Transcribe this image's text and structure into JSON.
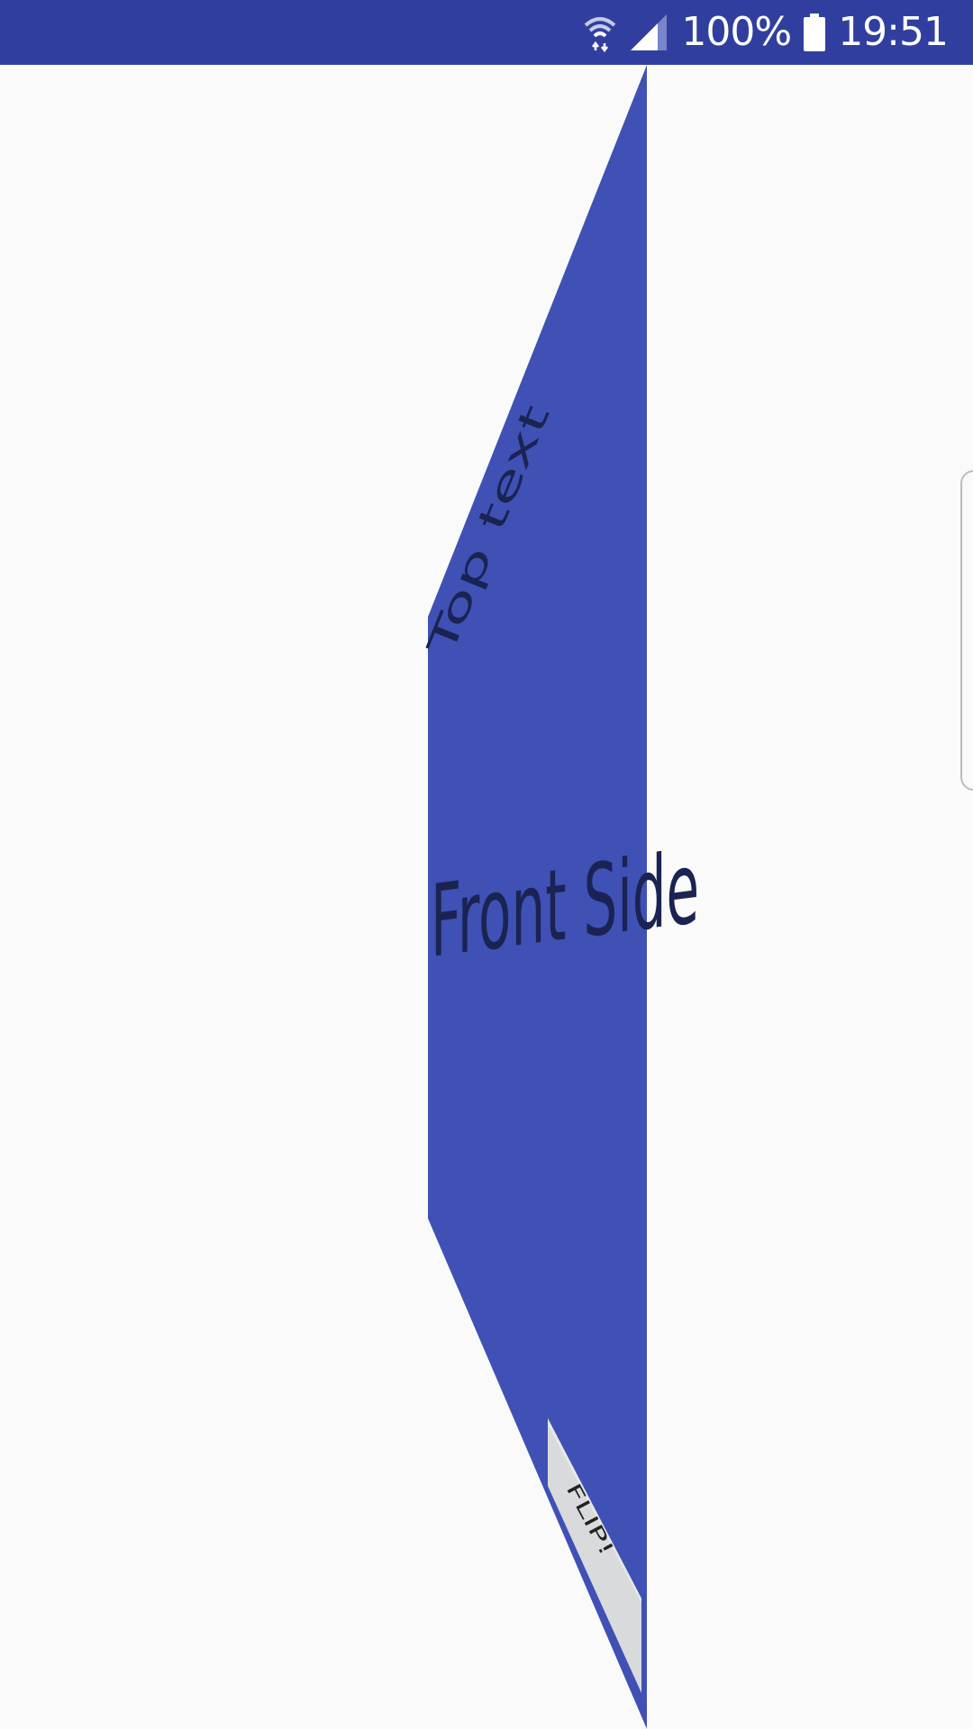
{
  "status_bar": {
    "battery_percent": "100%",
    "time": "19:51",
    "wifi_icon": "wifi-icon",
    "signal_icon": "signal-icon",
    "battery_icon": "battery-icon",
    "color": "#303f9f"
  },
  "card": {
    "top_text": "Top text",
    "front_text": "Front Side",
    "color": "#3f51b5",
    "text_color": "#1a2352"
  },
  "flip_button": {
    "label": "FLIP!",
    "color": "#d9dadb"
  },
  "edge_panel_handle": {
    "icon": "edge-panel-handle"
  }
}
